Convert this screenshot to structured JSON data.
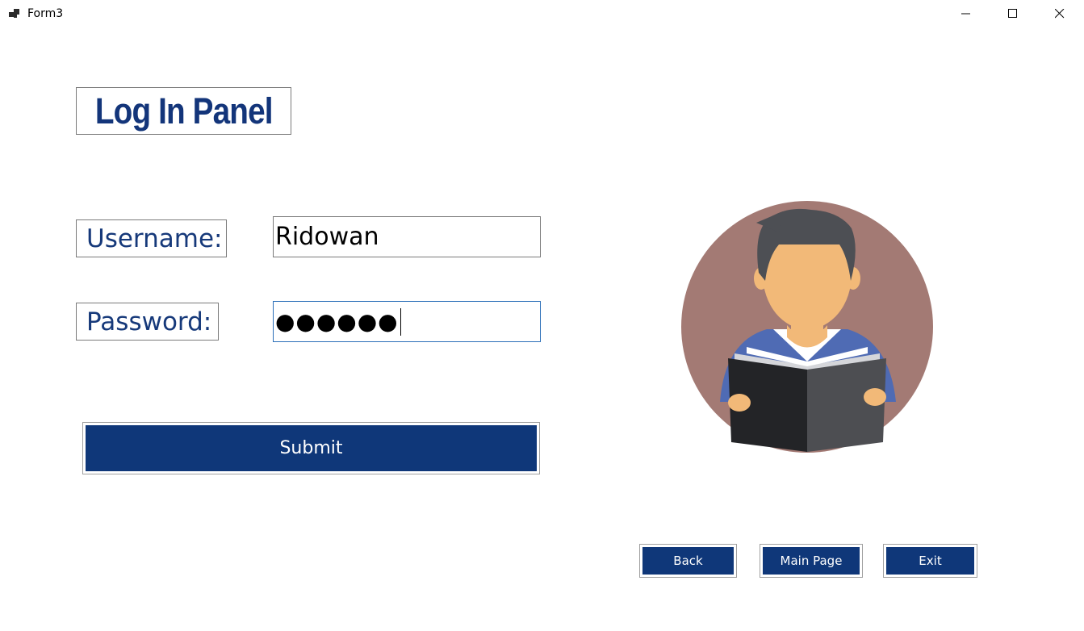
{
  "window": {
    "title": "Form3",
    "controls": {
      "minimize_icon": "minimize-icon",
      "maximize_icon": "maximize-icon",
      "close_icon": "close-icon"
    }
  },
  "form": {
    "heading": "Log In Panel",
    "username_label": "Username:",
    "username_value": "Ridowan",
    "password_label": "Password:",
    "password_masked": "●●●●●●",
    "submit_label": "Submit"
  },
  "illustration": {
    "icon": "person-reading-book-icon"
  },
  "nav": {
    "back_label": "Back",
    "main_page_label": "Main Page",
    "exit_label": "Exit"
  },
  "colors": {
    "accent": "#0f3779",
    "label_text": "#16397a",
    "avatar_bg": "#a37a74"
  }
}
